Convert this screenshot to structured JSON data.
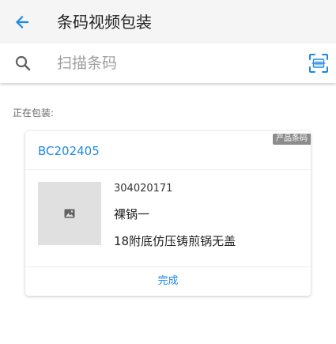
{
  "header": {
    "title": "条码视频包装",
    "back_icon": "arrow-left-icon",
    "background": "#f5f5f5"
  },
  "search": {
    "placeholder": "扫描条码",
    "value": "",
    "search_icon": "search-icon",
    "scan_icon": "barcode-scan-icon"
  },
  "section": {
    "label": "正在包装:"
  },
  "card": {
    "badge": "产品条码",
    "code": "BC202405",
    "item": {
      "image_icon": "image-placeholder-icon",
      "code": "304020171",
      "name": "裸锅一",
      "description": "18附底仿压铸煎锅无盖"
    },
    "action_label": "完成"
  },
  "colors": {
    "accent": "#1e88e5",
    "badge_bg": "#8c8c8c",
    "placeholder_text": "#9e9e9e",
    "thumb_bg": "#e0e0e0"
  }
}
